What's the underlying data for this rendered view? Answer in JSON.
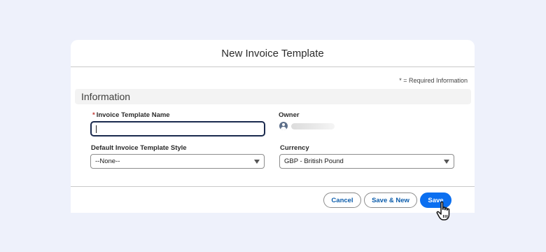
{
  "modal": {
    "title": "New Invoice Template",
    "required_note": "* = Required Information"
  },
  "section": {
    "title": "Information"
  },
  "fields": {
    "template_name": {
      "required_marker": "*",
      "label": "Invoice Template Name",
      "value": ""
    },
    "owner": {
      "label": "Owner",
      "icon": "user-avatar-icon"
    },
    "template_style": {
      "label": "Default Invoice Template Style",
      "value": "--None--",
      "icon": "chevron-down-icon"
    },
    "currency": {
      "label": "Currency",
      "value": "GBP - British Pound",
      "icon": "chevron-down-icon"
    }
  },
  "footer": {
    "cancel_label": "Cancel",
    "save_new_label": "Save & New",
    "save_label": "Save"
  },
  "cursor": {
    "icon": "hand-pointer-icon"
  },
  "colors": {
    "backdrop": "#eef1fb",
    "brand_blue": "#0b6ff0",
    "link_blue": "#0b5cab",
    "required_red": "#c23934",
    "focus_border": "#1b2a4e"
  }
}
